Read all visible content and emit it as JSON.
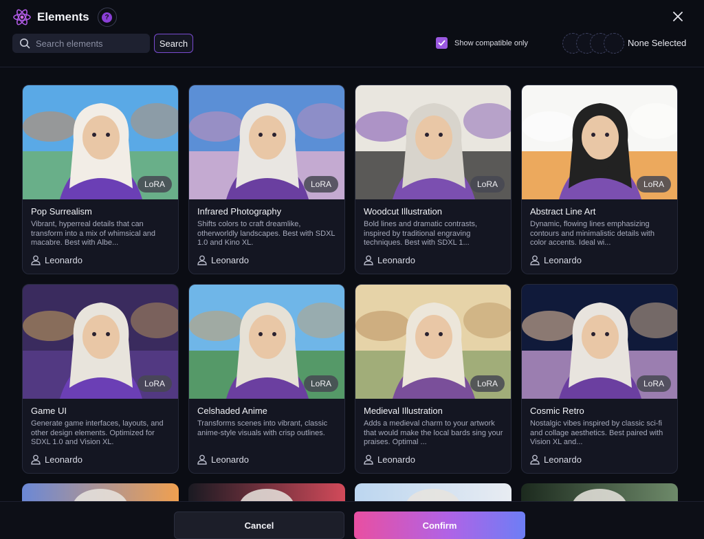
{
  "header": {
    "title": "Elements",
    "help_glyph": "?",
    "search_placeholder": "Search elements",
    "search_button": "Search",
    "compatible_label": "Show compatible only",
    "compatible_checked": true,
    "selection_status": "None Selected",
    "accent_color": "#9a58e0"
  },
  "cards": [
    {
      "name": "Pop Surrealism",
      "badge": "LoRA",
      "description": "Vibrant, hyperreal details that can transform into a mix of whimsical and macabre. Best with Albe...",
      "author": "Leonardo",
      "palette": [
        "#5aa9e6",
        "#6fb26a",
        "#c98b5a",
        "#f2ede6",
        "#6b3fb5"
      ]
    },
    {
      "name": "Infrared Photography",
      "badge": "LoRA",
      "description": "Shifts colors to craft dreamlike, otherworldly landscapes. Best with SDXL 1.0 and Kino XL.",
      "author": "Leonardo",
      "palette": [
        "#5b8fd6",
        "#e7b3cf",
        "#c98fb8",
        "#e9e6e2",
        "#6a3fa0"
      ]
    },
    {
      "name": "Woodcut Illustration",
      "badge": "LoRA",
      "description": "Bold lines and dramatic contrasts, inspired by traditional engraving techniques. Best with SDXL 1...",
      "author": "Leonardo",
      "palette": [
        "#e9e6df",
        "#2a2a2a",
        "#7b4fb0",
        "#d8d4cc",
        "#7b4fb0"
      ]
    },
    {
      "name": "Abstract Line Art",
      "badge": "LoRA",
      "description": "Dynamic, flowing lines emphasizing contours and minimalistic details with color accents. Ideal wi...",
      "author": "Leonardo",
      "palette": [
        "#f7f7f5",
        "#e88f2a",
        "#ffffff",
        "#222222",
        "#7b4fb0"
      ]
    },
    {
      "name": "Game UI",
      "badge": "LoRA",
      "description": "Generate game interfaces, layouts, and other design elements. Optimized for SDXL 1.0 and Vision XL.",
      "author": "Leonardo",
      "palette": [
        "#3a2b5e",
        "#5b3f8f",
        "#c9a45a",
        "#e8e4dc",
        "#6b3fb5"
      ]
    },
    {
      "name": "Celshaded Anime",
      "badge": "LoRA",
      "description": "Transforms scenes into vibrant, classic anime-style visuals with crisp outlines.",
      "author": "Leonardo",
      "palette": [
        "#6fb6e8",
        "#4c8f3e",
        "#c9a06a",
        "#e6e1d6",
        "#6b3fa0"
      ]
    },
    {
      "name": "Medieval Illustration",
      "badge": "LoRA",
      "description": "Adds a medieval charm to your artwork that would make the local bards sing your praises. Optimal ...",
      "author": "Leonardo",
      "palette": [
        "#e6d3a8",
        "#8aa06a",
        "#b9905e",
        "#ece6da",
        "#7a4f9a"
      ]
    },
    {
      "name": "Cosmic Retro",
      "badge": "LoRA",
      "description": "Nostalgic vibes inspired by classic sci-fi and collage aesthetics. Best paired with Vision XL and...",
      "author": "Leonardo",
      "palette": [
        "#101a3a",
        "#c9a0d8",
        "#f0c9a0",
        "#e8e4de",
        "#6b3fa0"
      ]
    }
  ],
  "peek_palettes": [
    [
      "#6b88d6",
      "#f0a050"
    ],
    [
      "#1a1a22",
      "#d24a5a"
    ],
    [
      "#bcd6f0",
      "#e8ecf2"
    ],
    [
      "#1c2a1e",
      "#6e8a6a"
    ]
  ],
  "footer": {
    "cancel": "Cancel",
    "confirm": "Confirm"
  }
}
